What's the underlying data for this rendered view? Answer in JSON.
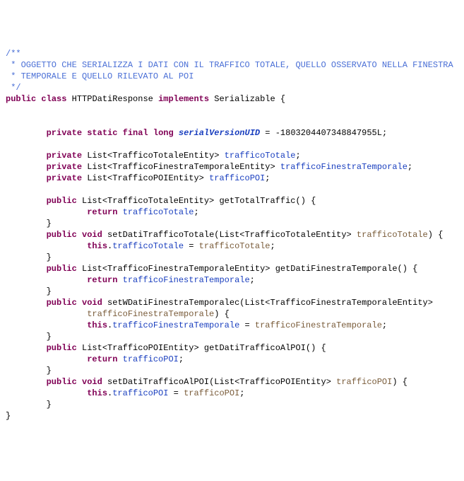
{
  "comment": {
    "l1": "/**",
    "l2": " * OGGETTO CHE SERIALIZZA I DATI CON IL TRAFFICO TOTALE, QUELLO OSSERVATO NELLA FINESTRA",
    "l3": " * TEMPORALE E QUELLO RILEVATO AL POI",
    "l4": " */"
  },
  "kw": {
    "public": "public",
    "class": "class",
    "implements": "implements",
    "private": "private",
    "static": "static",
    "final": "final",
    "long": "long",
    "void": "void",
    "return": "return",
    "this": "this"
  },
  "cls": {
    "name": "HTTPDatiResponse",
    "iface": "Serializable"
  },
  "suid": {
    "name": "serialVersionUID",
    "val": "-1803204407348847955L"
  },
  "types": {
    "tt": "List<TrafficoTotaleEntity>",
    "tft": "List<TrafficoFinestraTemporaleEntity>",
    "tpoi": "List<TrafficoPOIEntity>"
  },
  "fields": {
    "tt": "trafficoTotale",
    "tft": "trafficoFinestraTemporale",
    "tpoi": "trafficoPOI"
  },
  "methods": {
    "getTotal": "getTotalTraffic",
    "setTT": "setDatiTrafficoTotale",
    "getFT": "getDatiFinestraTemporale",
    "setFT": "setWDatiFinestraTemporalec",
    "getPOI": "getDatiTrafficoAlPOI",
    "setPOI": "setDatiTrafficoAlPOI"
  },
  "params": {
    "tt": "trafficoTotale",
    "tft": "trafficoFinestraTemporale",
    "tpoi": "trafficoPOI"
  }
}
